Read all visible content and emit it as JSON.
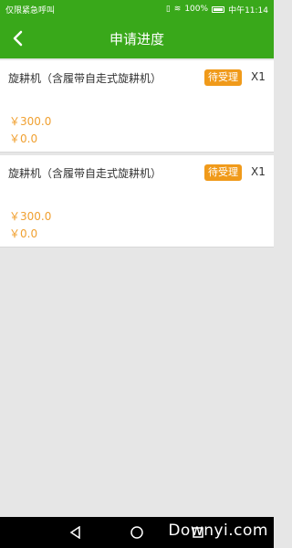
{
  "status_bar": {
    "left_text": "仅限紧急呼叫",
    "battery_percent": "100%",
    "time": "中午11:14"
  },
  "header": {
    "title": "申请进度"
  },
  "items": [
    {
      "name": "旋耕机（含履带自走式旋耕机）",
      "status": "待受理",
      "quantity": "X1",
      "price_line1": "￥300.0",
      "price_line2": "￥0.0"
    },
    {
      "name": "旋耕机（含履带自走式旋耕机）",
      "status": "待受理",
      "quantity": "X1",
      "price_line1": "￥300.0",
      "price_line2": "￥0.0"
    }
  ],
  "colors": {
    "header_green": "#39a81a",
    "badge_orange": "#f09a1a",
    "price_orange": "#f0a030"
  },
  "watermark": "Downyi.com"
}
